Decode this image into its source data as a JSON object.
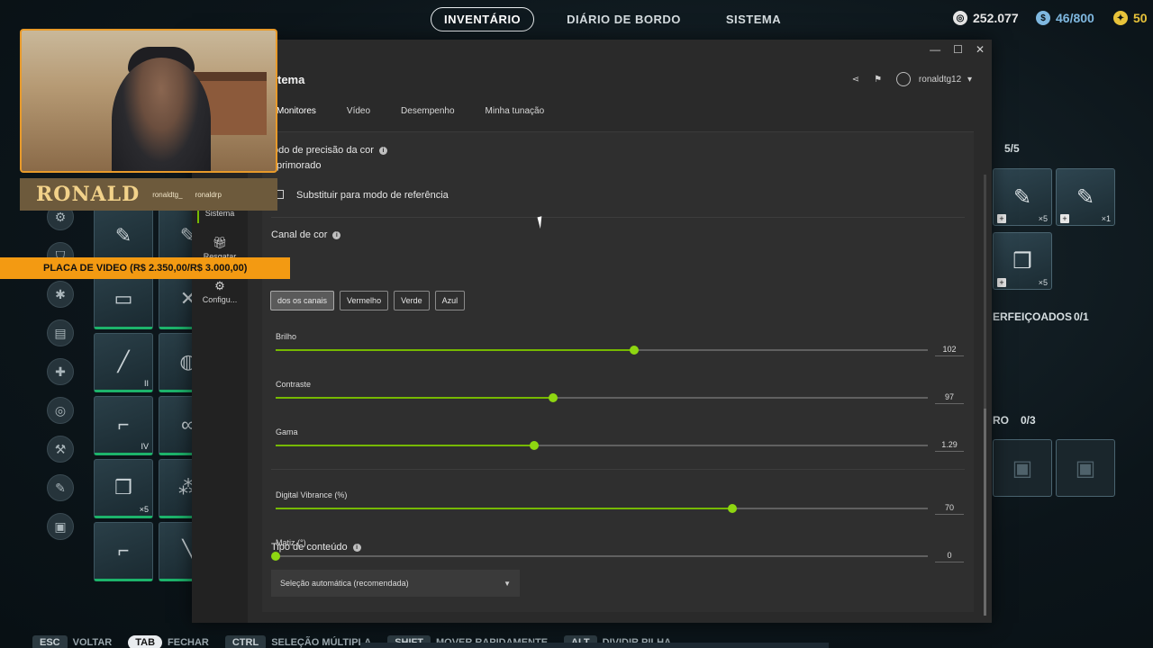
{
  "game": {
    "nav": [
      {
        "label": "INVENTÁRIO",
        "active": true
      },
      {
        "label": "DIÁRIO DE BORDO",
        "active": false
      },
      {
        "label": "SISTEMA",
        "active": false
      }
    ],
    "currency": {
      "money": "252.077",
      "capacity": "46/800",
      "other": "50"
    },
    "right_panel": {
      "count_label": "5/5",
      "item1_qty": "×5",
      "item2_qty": "×1",
      "item3_qty": "×5",
      "upgrades_label": "ERFEIÇOADOS",
      "upgrades_count": "0/1",
      "slot_label": "RO",
      "slot_count": "0/3"
    },
    "left_grid": {
      "qty_a": "×5",
      "tag_ii": "II",
      "tag_iv": "IV"
    },
    "hints": [
      {
        "key": "ESC",
        "label": "VOLTAR"
      },
      {
        "key": "TAB",
        "label": "FECHAR"
      },
      {
        "key": "CTRL",
        "label": "SELEÇÃO MÚLTIPLA"
      },
      {
        "key": "SHIFT",
        "label": "MOVER RAPIDAMENTE"
      },
      {
        "key": "ALT",
        "label": "DIVIDIR PILHA"
      }
    ]
  },
  "stream": {
    "name_logo": "RONALD",
    "social_1": "ronaldtg_",
    "social_2": "ronaldrp",
    "price_banner": "PLACA DE VIDEO (R$ 2.350,00/R$ 3.000,00)"
  },
  "window": {
    "title": "tema",
    "username": "ronaldtg12",
    "sidebar": {
      "sistema": "Sistema",
      "resgatar": "Resgatar",
      "config": "Configu..."
    },
    "tabs": [
      "Monitores",
      "Vídeo",
      "Desempenho",
      "Minha tunação"
    ],
    "precision": {
      "label": "odo de precisão da cor",
      "value": "primorado"
    },
    "reference_mode_label": "Substituir para modo de referência",
    "channel": {
      "label": "Canal de cor",
      "buttons": [
        "dos os canais",
        "Vermelho",
        "Verde",
        "Azul"
      ]
    },
    "sliders": [
      {
        "name": "brightness",
        "label": "Brilho",
        "value": "102",
        "fraction": 0.55
      },
      {
        "name": "contrast",
        "label": "Contraste",
        "value": "97",
        "fraction": 0.425
      },
      {
        "name": "gamma",
        "label": "Gama",
        "value": "1.29",
        "fraction": 0.397
      },
      {
        "name": "vibrance",
        "label": "Digital Vibrance (%)",
        "value": "70",
        "fraction": 0.7
      },
      {
        "name": "hue",
        "label": "Matiz (°)",
        "value": "0",
        "fraction": 0.0
      }
    ],
    "content_type": {
      "label": "Tipo de conteúdo",
      "selected": "Seleção automática (recomendada)"
    }
  }
}
